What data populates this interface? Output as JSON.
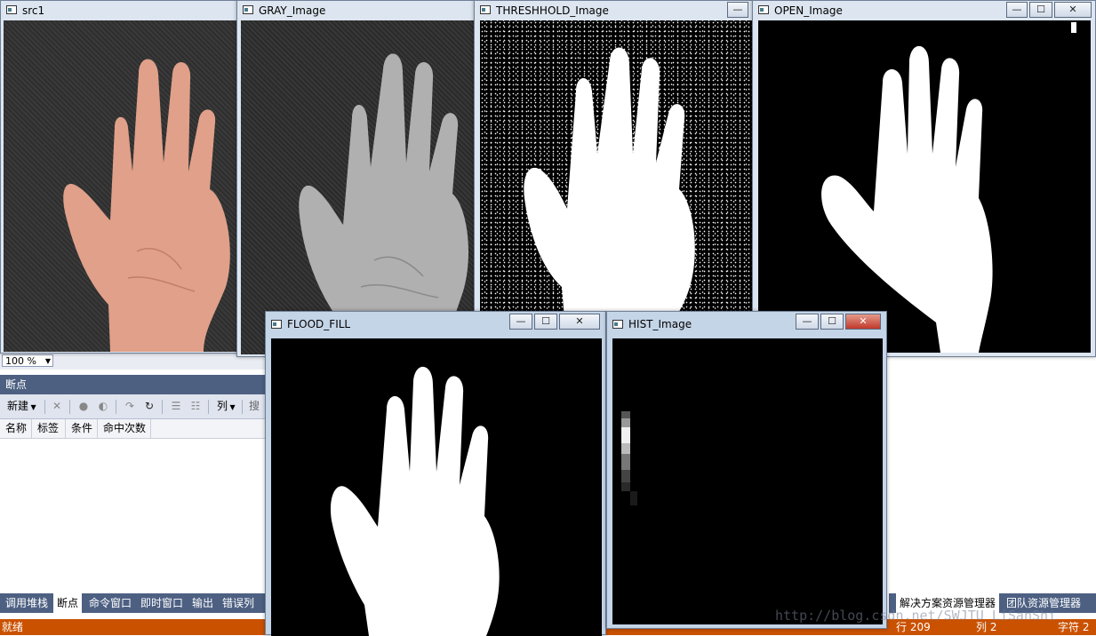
{
  "ide": {
    "zoom": "100 %",
    "breakpoints_title": "断点",
    "toolbar": {
      "new_label": "新建",
      "columns_label": "列",
      "search_label": "搜"
    },
    "columns": [
      "名称",
      "标签",
      "条件",
      "命中次数"
    ],
    "bottom_tabs": [
      "调用堆栈",
      "断点",
      "命令窗口",
      "即时窗口",
      "输出",
      "错误列表"
    ],
    "active_bottom_tab": "断点",
    "right_tabs": [
      "解决方案资源管理器",
      "团队资源管理器"
    ],
    "status": {
      "ready": "就绪",
      "line": "行 209",
      "col": "列 2",
      "char": "字符 2"
    },
    "accent_color": "#ca5100",
    "panel_color": "#4d6082"
  },
  "windows": {
    "src1": {
      "title": "src1"
    },
    "gray": {
      "title": "GRAY_Image"
    },
    "threshold": {
      "title": "THRESHHOLD_Image"
    },
    "open": {
      "title": "OPEN_Image"
    },
    "flood": {
      "title": "FLOOD_FILL"
    },
    "hist": {
      "title": "HIST_Image"
    }
  },
  "watermark": "http://blog.csdn.net/SWJTU_LiSanShi"
}
